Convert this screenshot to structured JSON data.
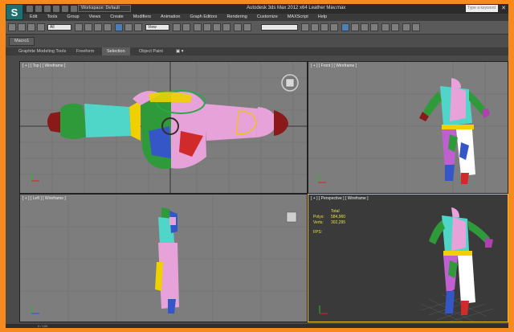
{
  "app": {
    "title": "Autodesk 3ds Max  2012 x64    Leather Mav.max",
    "logo": "S",
    "workspace": "Workspace: Default",
    "search_placeholder": "Type a keyword",
    "close_glyph": "✕"
  },
  "menu": [
    "Edit",
    "Tools",
    "Group",
    "Views",
    "Create",
    "Modifiers",
    "Animation",
    "Graph Editors",
    "Rendering",
    "Customize",
    "MAXScript",
    "Help"
  ],
  "toolbar": {
    "selection_filter": "All",
    "ref_coord": "View"
  },
  "tabs": {
    "macro": "Macro1"
  },
  "ribbon": {
    "items": [
      "Graphite Modeling Tools",
      "Freeform",
      "Selection",
      "Object Paint"
    ],
    "active": "Selection"
  },
  "viewports": {
    "top": {
      "label": "[ + ] [ Top ] [ Wireframe ]"
    },
    "front": {
      "label": "[ + ] [ Front ] [ Wireframe ]"
    },
    "left": {
      "label": "[ + ] [ Left ] [ Wireframe ]"
    },
    "perspective": {
      "label": "[ + ] [ Perspective ] [ Wireframe ]"
    }
  },
  "stats": {
    "header": "Total",
    "polys_label": "Polys:",
    "polys_value": "584,960",
    "verts_label": "Verts:",
    "verts_value": "302,295",
    "fps_label": "FPS:"
  },
  "status": {
    "text": "0 / 100"
  },
  "colors": {
    "frame": "#f58a1f",
    "viewport_bg": "#7d7d7d",
    "active_border": "#f0c020",
    "stats_text": "#e8e040"
  }
}
